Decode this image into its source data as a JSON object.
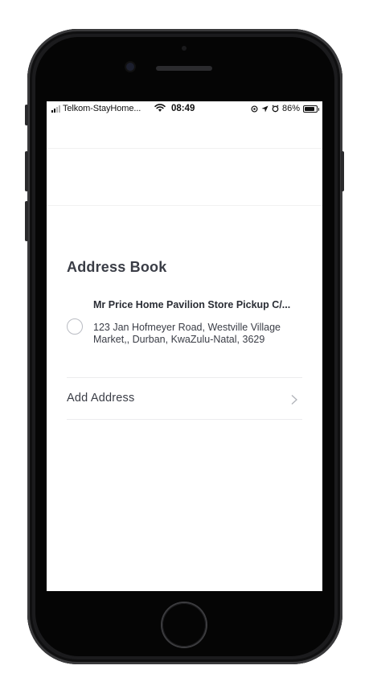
{
  "status_bar": {
    "carrier": "Telkom-StayHome...",
    "time": "08:49",
    "battery": "86%",
    "battery_level": 0.86
  },
  "page": {
    "title": "Address Book"
  },
  "address": {
    "name": "Mr Price Home Pavilion Store Pickup C/...",
    "line1": "123 Jan Hofmeyer Road, Westville Village",
    "line2": "Market,, Durban, KwaZulu-Natal, 3629",
    "selected": false
  },
  "actions": {
    "add_address": "Add Address"
  },
  "icons": {
    "signal": "signal-icon",
    "wifi": "wifi-icon",
    "location": "location-arrow-icon",
    "alarm": "alarm-icon",
    "battery": "battery-icon",
    "chevron": "chevron-right-icon"
  }
}
